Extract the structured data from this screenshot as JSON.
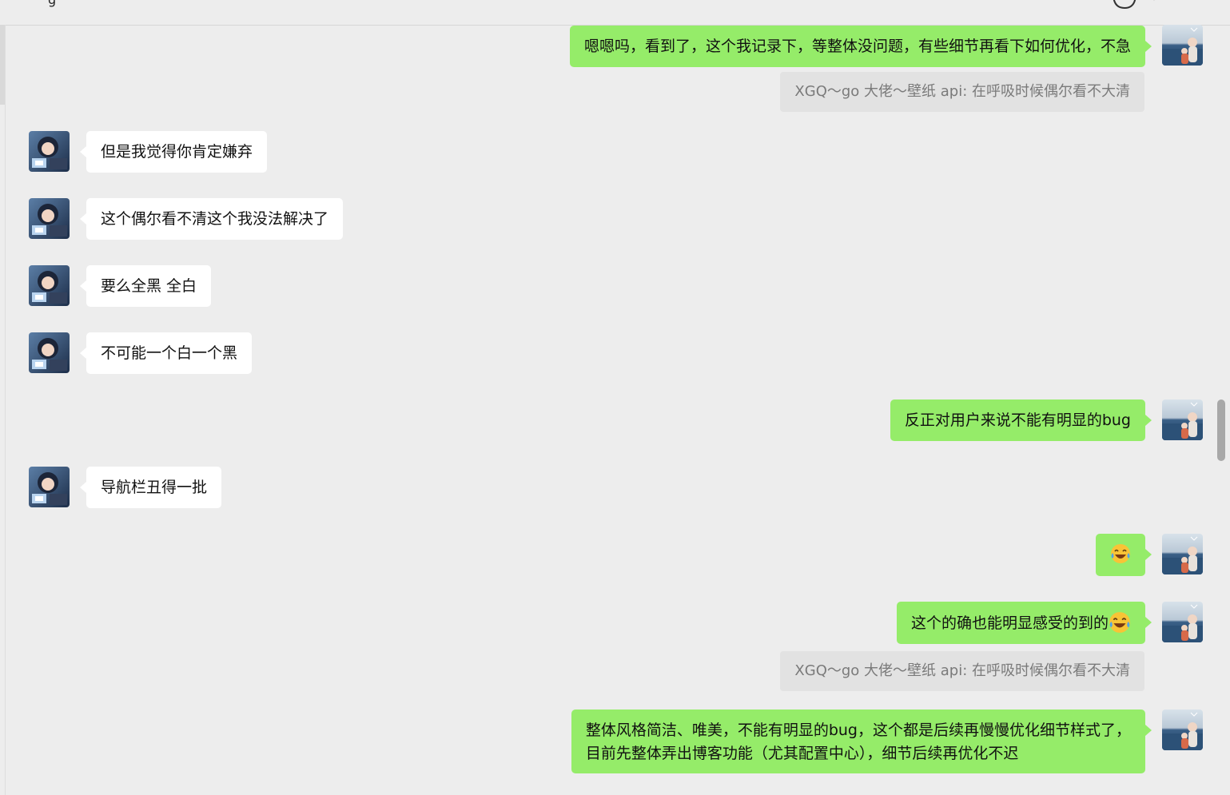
{
  "header": {
    "title_fragment": "g"
  },
  "colors": {
    "background": "#ededed",
    "outgoing_bubble": "#95ec69",
    "incoming_bubble": "#ffffff",
    "quote_bg": "#e2e2e2",
    "quote_text": "#7a7a7a"
  },
  "messages": [
    {
      "dir": "out",
      "text": "嗯嗯吗，看到了，这个我记录下，等整体没问题，有些细节再看下如何优化，不急"
    },
    {
      "dir": "quote",
      "text": "XGQ～go 大佬～壁纸 api: 在呼吸时候偶尔看不大清"
    },
    {
      "dir": "in",
      "text": "但是我觉得你肯定嫌弃"
    },
    {
      "dir": "in",
      "text": "这个偶尔看不清这个我没法解决了"
    },
    {
      "dir": "in",
      "text": "要么全黑 全白"
    },
    {
      "dir": "in",
      "text": "不可能一个白一个黑"
    },
    {
      "dir": "out",
      "text": "反正对用户来说不能有明显的bug"
    },
    {
      "dir": "in",
      "text": "导航栏丑得一批"
    },
    {
      "dir": "out",
      "emoji": "laughing-crying-emoji"
    },
    {
      "dir": "out",
      "text": "这个的确也能明显感受的到的"
    },
    {
      "dir": "quote",
      "text": "XGQ～go 大佬～壁纸 api: 在呼吸时候偶尔看不大清"
    },
    {
      "dir": "out",
      "line1": "整体风格简洁、唯美，不能有明显的bug，这个都是后续再慢慢优化细节样式了，",
      "line2": "目前先整体弄出博客功能（尤其配置中心），细节后续再优化不迟"
    }
  ]
}
